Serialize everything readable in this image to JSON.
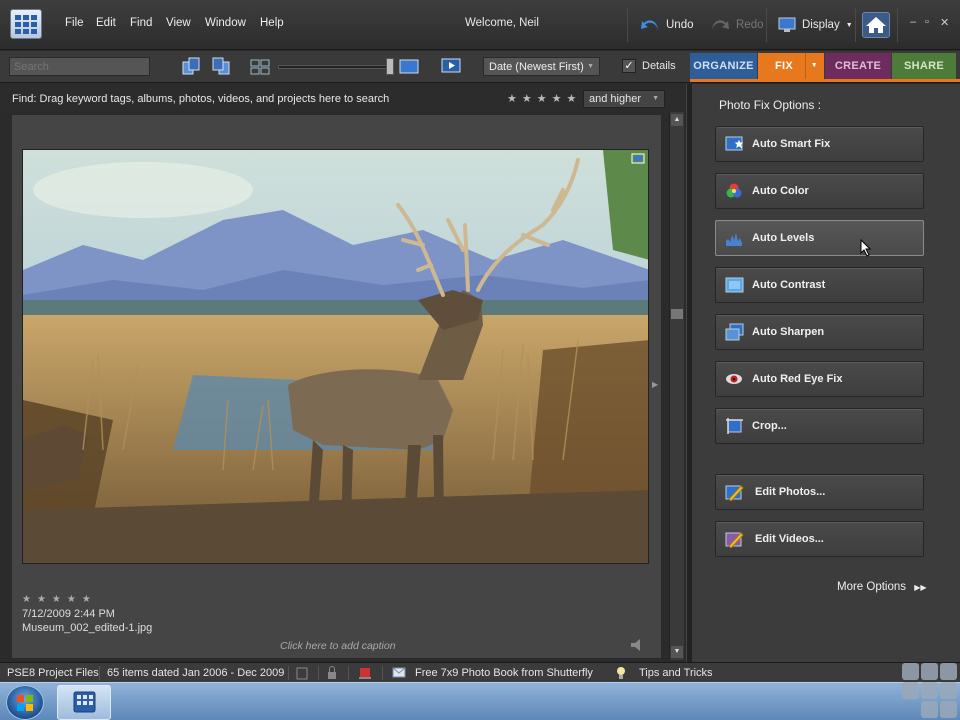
{
  "menubar": {
    "items": [
      "File",
      "Edit",
      "Find",
      "View",
      "Window",
      "Help"
    ],
    "welcome": "Welcome, Neil",
    "undo": "Undo",
    "redo": "Redo",
    "display": "Display",
    "win_controls": [
      "–",
      "▫",
      "✕"
    ]
  },
  "toolbar": {
    "search_placeholder": "Search",
    "sort": "Date (Newest First)",
    "details_checked": true,
    "details_label": "Details",
    "check_glyph": "✓",
    "tabs": [
      {
        "label": "ORGANIZE",
        "color": "#2e5d98"
      },
      {
        "label": "FIX",
        "color": "#e8781e"
      },
      {
        "label": "CREATE",
        "color": "#6e2c5e"
      },
      {
        "label": "SHARE",
        "color": "#4d7b3a"
      }
    ]
  },
  "findbar": {
    "text": "Find: Drag keyword tags, albums, photos, videos, and projects here to search",
    "stars": "★★★★★",
    "rating_filter": "and higher"
  },
  "media": {
    "photo": {
      "stars": "★★★★★",
      "date": "7/12/2009 2:44 PM",
      "filename": "Museum_002_edited-1.jpg",
      "caption": "Click here to add caption"
    }
  },
  "fixpanel": {
    "title": "Photo Fix Options :",
    "buttons": [
      {
        "label": "Auto Smart Fix",
        "icon": "smart-fix-icon"
      },
      {
        "label": "Auto Color",
        "icon": "color-wheel-icon"
      },
      {
        "label": "Auto Levels",
        "icon": "levels-icon"
      },
      {
        "label": "Auto Contrast",
        "icon": "contrast-icon"
      },
      {
        "label": "Auto Sharpen",
        "icon": "sharpen-icon"
      },
      {
        "label": "Auto Red Eye Fix",
        "icon": "red-eye-icon"
      },
      {
        "label": "Crop...",
        "icon": "crop-icon"
      },
      {
        "label": "Edit Photos...",
        "icon": "edit-photos-icon"
      },
      {
        "label": "Edit Videos...",
        "icon": "edit-videos-icon"
      }
    ],
    "more_options": "More Options"
  },
  "statusbar": {
    "project": "PSE8 Project Files",
    "items_range": "65 items dated Jan 2006 - Dec 2009",
    "promo": "Free 7x9 Photo Book from Shutterfly",
    "tips": "Tips and Tricks"
  },
  "colors": {
    "accent_fix": "#e8781e",
    "organize": "#2e5d98",
    "create": "#6e2c5e",
    "share": "#4d7b3a"
  }
}
